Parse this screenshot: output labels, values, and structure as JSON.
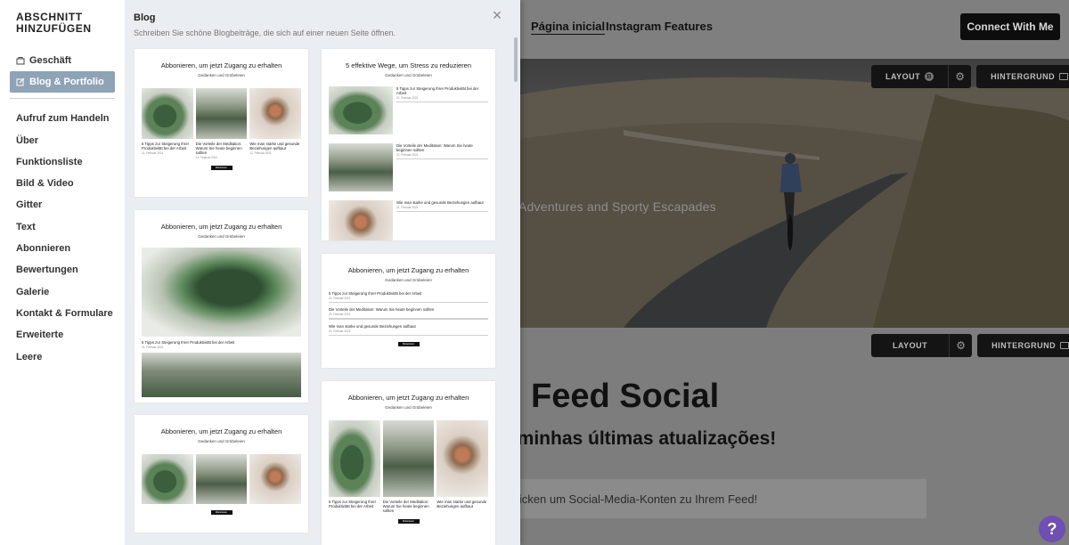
{
  "site": {
    "nav": {
      "home": "Página inicial",
      "instagram": "Instagram Features"
    },
    "connect_button": "Connect With Me",
    "hero_caption": "Adventures and Sporty Escapades",
    "toolbar": {
      "layout": "LAYOUT",
      "layout_badge": "B",
      "background": "HINTERGRUND"
    },
    "feed_title": "Feed Social",
    "feed_subtitle": "n minhas últimas atualizações!",
    "feed_notice": "licken um Social-Media-Konten zu Ihrem Feed!",
    "help": "?"
  },
  "panel": {
    "title": "ABSCHNITT HINZUFÜGEN",
    "categories_top": [
      {
        "label": "Geschäft",
        "icon": "bag-icon"
      },
      {
        "label": "Blog & Portfolio",
        "icon": "edit-icon",
        "active": true
      }
    ],
    "categories": [
      "Aufruf zum Handeln",
      "Über",
      "Funktionsliste",
      "Bild & Video",
      "Gitter",
      "Text",
      "Abonnieren",
      "Bewertungen",
      "Galerie",
      "Kontakt & Formulare",
      "Erweiterte",
      "Leere"
    ],
    "blog": {
      "heading": "Blog",
      "description": "Schreiben Sie schöne Blogbeiträge, die sich auf einer neuen Seite öffnen.",
      "close": "×",
      "card_title": "Abbonieren, um jetzt Zugang zu erhalten",
      "card_sub": "Gedanken und Grübeleien",
      "card_title_alt": "5 effektive Wege, um Stress zu reduzieren",
      "posts": [
        {
          "title": "5 Tipps zur Steigerung Ihrer Produktivität bei der Arbeit",
          "meta": "21. Februar 2021"
        },
        {
          "title": "Die Vorteile der Meditation: Warum Sie heute beginnen sollten",
          "meta": "21. Februar 2021"
        },
        {
          "title": "Wie man starke und gesunde Beziehungen aufbaut",
          "meta": "21. Februar 2021"
        }
      ],
      "button": "Weiterlesen"
    }
  }
}
